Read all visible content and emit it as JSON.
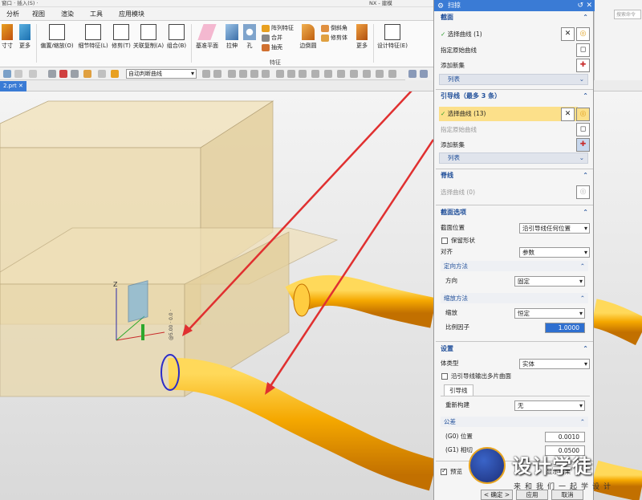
{
  "topstrip": {
    "left_text": "窗口 · 插入(S) ·",
    "title": "NX - 建模"
  },
  "menu": {
    "tabs": [
      "分析",
      "视图",
      "渲染",
      "工具",
      "应用模块"
    ]
  },
  "ribbon": {
    "buttons": [
      {
        "label": "寸寸",
        "icon": "dimension-icon"
      },
      {
        "label": "更多",
        "icon": "more-icon"
      },
      {
        "label": "偏置/缩放(O)",
        "icon": "offset-icon"
      },
      {
        "label": "细节特征(L)",
        "icon": "detail-feature-icon"
      },
      {
        "label": "修剪(T)",
        "icon": "trim-icon"
      },
      {
        "label": "关联复制(A)",
        "icon": "assoc-copy-icon"
      },
      {
        "label": "组合(B)",
        "icon": "combine-icon"
      },
      {
        "label": "基准平面",
        "icon": "datum-plane-icon"
      },
      {
        "label": "拉伸",
        "icon": "extrude-icon"
      },
      {
        "label": "孔",
        "icon": "hole-icon"
      },
      {
        "label": "阵列特征",
        "icon": "pattern-icon"
      },
      {
        "label": "合并",
        "icon": "unite-icon"
      },
      {
        "label": "抽壳",
        "icon": "shell-icon"
      },
      {
        "label": "边倒圆",
        "icon": "edge-blend-icon"
      },
      {
        "label": "倒斜角",
        "icon": "chamfer-icon"
      },
      {
        "label": "修剪体",
        "icon": "trim-body-icon"
      },
      {
        "label": "更多",
        "icon": "more-icon"
      },
      {
        "label": "设计特征(E)",
        "icon": "design-feature-icon"
      }
    ],
    "group_label": "特征"
  },
  "toolbar": {
    "select_value": "自动判断曲线"
  },
  "tabrow": {
    "file_tab": "2.prt"
  },
  "search": {
    "placeholder": "搜索命令"
  },
  "dialog": {
    "title": "扫掠",
    "section": {
      "header": "截面",
      "select_curve": "选择曲线 (1)",
      "specify_origin": "指定原始曲线",
      "add_new": "添加新集",
      "list": "列表"
    },
    "guide": {
      "header": "引导线（最多 3 条）",
      "select_curve": "选择曲线 (13)",
      "specify_origin": "指定原始曲线",
      "add_new": "添加新集",
      "list": "列表"
    },
    "spine": {
      "header": "脊线",
      "select_curve": "选择曲线 (0)"
    },
    "section_options": {
      "header": "截面选项",
      "position_label": "截面位置",
      "position_value": "沿引导线任何位置",
      "preserve_shape": "保留形状",
      "align_label": "对齐",
      "align_value": "参数",
      "orientation": {
        "header": "定向方法",
        "label": "方向",
        "value": "固定"
      },
      "scaling": {
        "header": "缩放方法",
        "label": "缩放",
        "value": "恒定",
        "factor_label": "比例因子",
        "factor_value": "1.0000"
      }
    },
    "settings": {
      "header": "设置",
      "body_type_label": "体类型",
      "body_type_value": "实体",
      "multi_face": "沿引导线输出多片曲面",
      "tab_guide": "引导线",
      "rebuild_label": "重新构建",
      "rebuild_value": "无",
      "tolerance": {
        "header": "公差",
        "g0_label": "(G0) 位置",
        "g0_value": "0.0010",
        "g1_label": "(G1) 相切",
        "g1_value": "0.0500"
      }
    },
    "preview": "预览",
    "show_result": "显示结果",
    "buttons": {
      "ok": "< 确定 >",
      "apply": "应用",
      "cancel": "取消"
    }
  },
  "viewport": {
    "triad_label": "Z",
    "dim_label": "@5.00 · 0.0 ·"
  },
  "logo": {
    "main": "设计学徒",
    "sub": "来和我们一起学设计"
  },
  "colors": {
    "accent": "#3a7bd5",
    "highlight": "#fce08a",
    "pipe": "#f5a800",
    "arrow": "#e03030",
    "block": "#eedcb0"
  }
}
